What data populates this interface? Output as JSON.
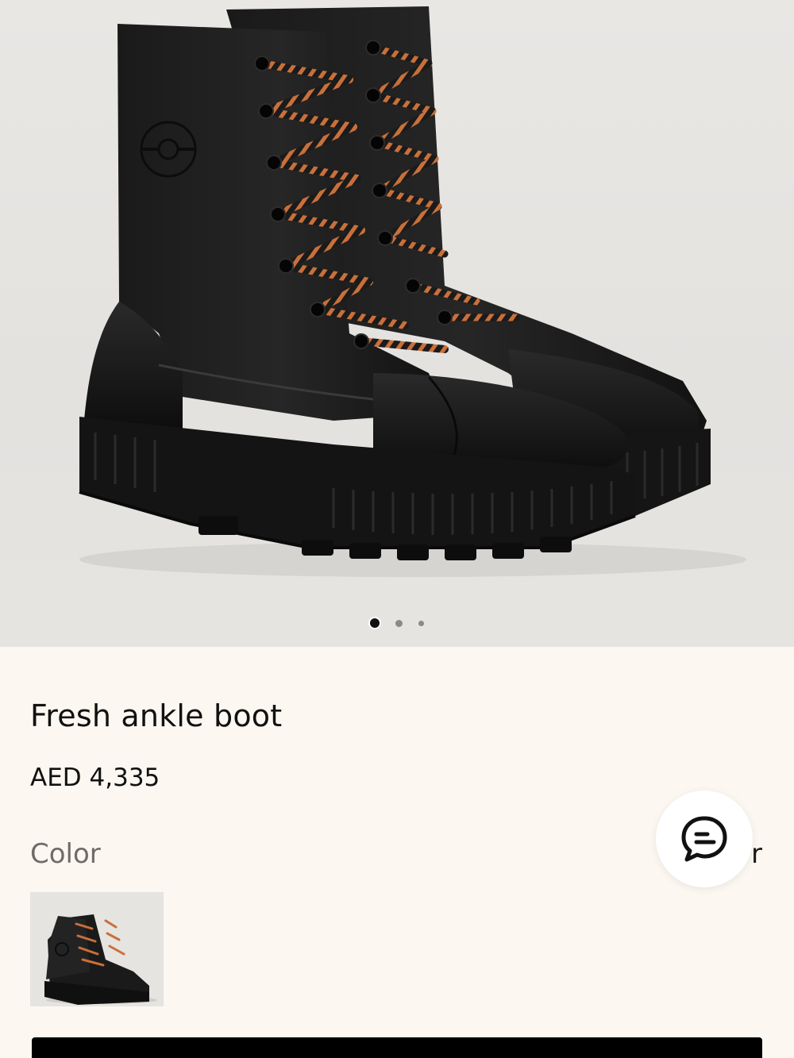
{
  "gallery": {
    "image_name": "fresh-ankle-boot-photo",
    "slide_count": 3,
    "active_slide": 1
  },
  "product": {
    "title": "Fresh ankle boot",
    "price": "AED 4,335"
  },
  "options": {
    "color_label": "Color",
    "size_label_partial": "r"
  },
  "chat": {
    "icon": "chat-bubble-icon"
  },
  "colors": {
    "background": "#fcf7f1",
    "boot": "#111111",
    "laces": "#c9703a",
    "cta": "#000000"
  }
}
